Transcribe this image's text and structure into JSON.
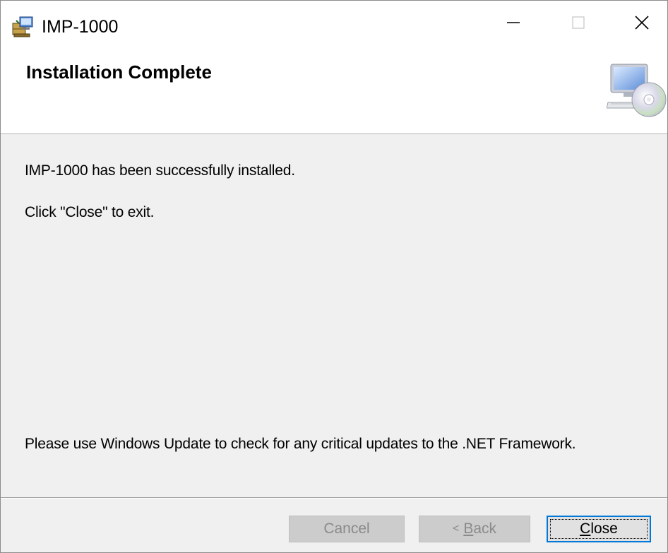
{
  "window": {
    "title": "IMP-1000",
    "icons": {
      "app": "installer-package-icon",
      "minimize": "minimize-icon",
      "maximize": "maximize-icon",
      "close": "close-icon"
    }
  },
  "header": {
    "title": "Installation Complete",
    "icon": "computer-with-cd-icon"
  },
  "body": {
    "message_installed": "IMP-1000 has been successfully installed.",
    "message_close": "Click \"Close\" to exit.",
    "message_update": "Please use Windows Update to check for any critical updates to the .NET Framework."
  },
  "buttons": {
    "cancel": {
      "label": "Cancel",
      "enabled": false
    },
    "back": {
      "arrow": "<",
      "mnemonic": "B",
      "rest": "ack",
      "enabled": false
    },
    "close": {
      "mnemonic": "C",
      "rest": "lose",
      "enabled": true,
      "focused": true
    }
  },
  "colors": {
    "dialog_bg": "#f0f0f0",
    "header_bg": "#ffffff",
    "focus_border": "#0078d7",
    "disabled_text": "#8a8a8a"
  }
}
